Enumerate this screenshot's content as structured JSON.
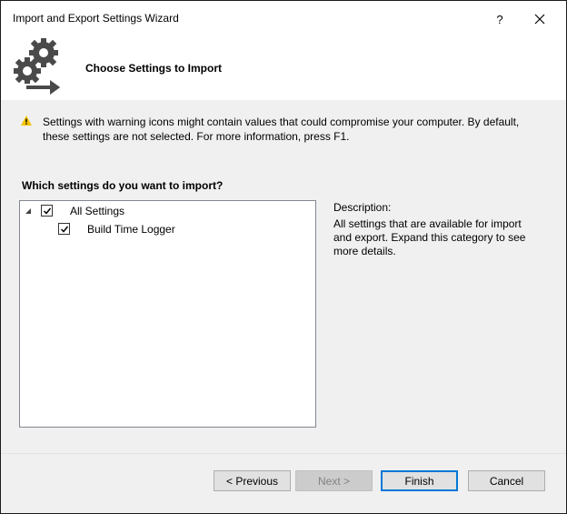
{
  "window": {
    "title": "Import and Export Settings Wizard",
    "help_label": "?",
    "step_title": "Choose Settings to Import"
  },
  "warning": {
    "icon": "warning-icon",
    "text": "Settings with warning icons might contain values that could compromise your computer. By default, these settings are not selected. For more information, press F1."
  },
  "settings": {
    "question": "Which settings do you want to import?",
    "tree": [
      {
        "label": "All Settings",
        "checked": true,
        "expanded": true,
        "level": 0
      },
      {
        "label": "Build Time Logger",
        "checked": true,
        "level": 1
      }
    ]
  },
  "description": {
    "title": "Description:",
    "text": "All settings that are available for import and export. Expand this category to see more details."
  },
  "buttons": {
    "previous": "< Previous",
    "next": "Next >",
    "finish": "Finish",
    "cancel": "Cancel"
  },
  "colors": {
    "default_button_border": "#0078d7",
    "warning_yellow": "#f5c400"
  }
}
